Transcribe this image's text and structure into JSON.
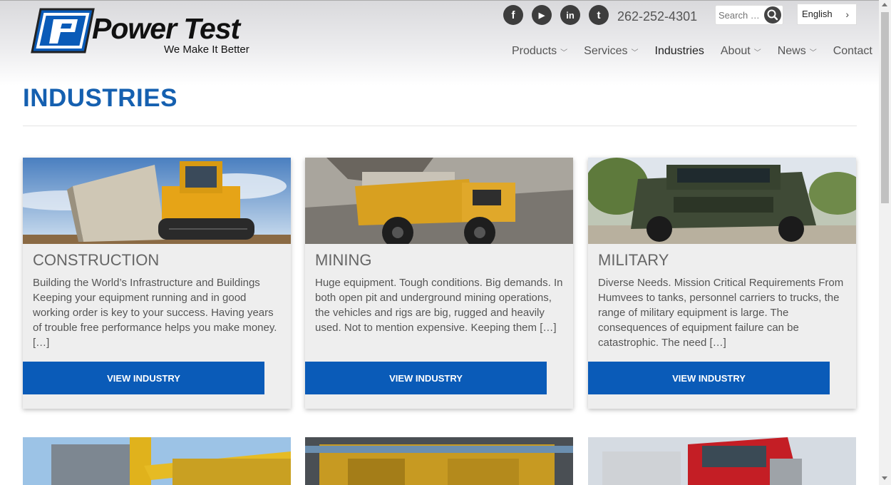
{
  "brand": {
    "name": "Power Test",
    "tagline": "We Make It Better",
    "logo_color": "#0a5bb8"
  },
  "header": {
    "social": [
      {
        "icon": "facebook-icon",
        "glyph": "f"
      },
      {
        "icon": "youtube-icon",
        "glyph": "▶"
      },
      {
        "icon": "linkedin-icon",
        "glyph": "in"
      },
      {
        "icon": "twitter-icon",
        "glyph": "t"
      }
    ],
    "phone": "262-252-4301",
    "search_placeholder": "Search …",
    "language": "English"
  },
  "nav": {
    "items": [
      {
        "label": "Products",
        "dropdown": true
      },
      {
        "label": "Services",
        "dropdown": true
      },
      {
        "label": "Industries",
        "dropdown": false
      },
      {
        "label": "About",
        "dropdown": true
      },
      {
        "label": "News",
        "dropdown": true
      },
      {
        "label": "Contact",
        "dropdown": false
      }
    ]
  },
  "page": {
    "title": "INDUSTRIES",
    "accent": "#1560b0"
  },
  "cards": [
    {
      "name": "CONSTRUCTION",
      "desc": "Building the World’s Infrastructure and Buildings Keeping your equipment running and in good working order is key to your success. Having years of trouble free performance helps you make money. […]",
      "button": "VIEW INDUSTRY"
    },
    {
      "name": "MINING",
      "desc": "Huge equipment. Tough conditions. Big demands. In both open pit and underground mining operations, the vehicles and rigs are big, rugged and heavily used. Not to mention expensive. Keeping them […]",
      "button": "VIEW INDUSTRY"
    },
    {
      "name": "MILITARY",
      "desc": "Diverse Needs. Mission Critical Requirements From Humvees to tanks, personnel carriers to trucks, the range of military equipment is large. The consequences of equipment failure can be catastrophic. The need […]",
      "button": "VIEW INDUSTRY"
    }
  ]
}
